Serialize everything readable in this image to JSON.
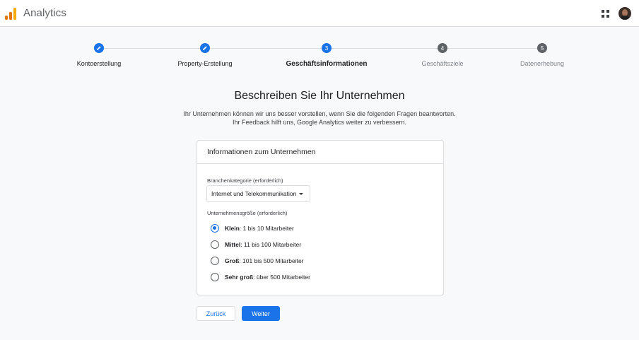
{
  "app": {
    "title": "Analytics"
  },
  "colors": {
    "accent": "#1a73e8",
    "step_todo": "#5f6368",
    "logo_dark": "#e37400",
    "logo_light": "#f9ab00"
  },
  "stepper": {
    "steps": [
      {
        "number": "",
        "label": "Kontoerstellung",
        "state": "done",
        "icon": "pencil-icon"
      },
      {
        "number": "",
        "label": "Property-Erstellung",
        "state": "done",
        "icon": "pencil-icon"
      },
      {
        "number": "3",
        "label": "Geschäftsinformationen",
        "state": "active"
      },
      {
        "number": "4",
        "label": "Geschäftsziele",
        "state": "todo"
      },
      {
        "number": "5",
        "label": "Datenerhebung",
        "state": "todo"
      }
    ]
  },
  "main": {
    "title": "Beschreiben Sie Ihr Unternehmen",
    "description_line1": "Ihr Unternehmen können wir uns besser vorstellen, wenn Sie die folgenden Fragen beantworten.",
    "description_line2": "Ihr Feedback hilft uns, Google Analytics weiter zu verbessern."
  },
  "card": {
    "title": "Informationen zum Unternehmen",
    "industry_label": "Branchenkategorie (erforderlich)",
    "industry_value": "Internet und Telekommunikation",
    "size_label": "Unternehmensgröße (erforderlich)",
    "size_options": [
      {
        "name": "Klein",
        "detail": ": 1 bis 10 Mitarbeiter",
        "selected": true
      },
      {
        "name": "Mittel",
        "detail": ": 11 bis 100 Mitarbeiter",
        "selected": false
      },
      {
        "name": "Groß",
        "detail": ": 101 bis 500 Mitarbeiter",
        "selected": false
      },
      {
        "name": "Sehr groß",
        "detail": ": über 500 Mitarbeiter",
        "selected": false
      }
    ]
  },
  "buttons": {
    "back": "Zurück",
    "next": "Weiter"
  },
  "header": {
    "apps_icon": "apps-grid-icon",
    "avatar": "account-avatar"
  }
}
